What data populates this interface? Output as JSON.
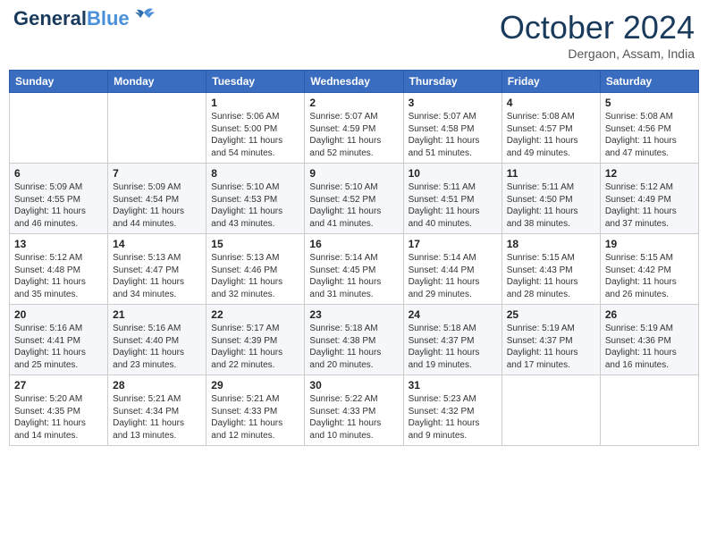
{
  "header": {
    "logo_line1": "General",
    "logo_line2": "Blue",
    "month": "October 2024",
    "location": "Dergaon, Assam, India"
  },
  "weekdays": [
    "Sunday",
    "Monday",
    "Tuesday",
    "Wednesday",
    "Thursday",
    "Friday",
    "Saturday"
  ],
  "weeks": [
    [
      {
        "day": null
      },
      {
        "day": null
      },
      {
        "day": 1,
        "sunrise": "Sunrise: 5:06 AM",
        "sunset": "Sunset: 5:00 PM",
        "daylight": "Daylight: 11 hours and 54 minutes."
      },
      {
        "day": 2,
        "sunrise": "Sunrise: 5:07 AM",
        "sunset": "Sunset: 4:59 PM",
        "daylight": "Daylight: 11 hours and 52 minutes."
      },
      {
        "day": 3,
        "sunrise": "Sunrise: 5:07 AM",
        "sunset": "Sunset: 4:58 PM",
        "daylight": "Daylight: 11 hours and 51 minutes."
      },
      {
        "day": 4,
        "sunrise": "Sunrise: 5:08 AM",
        "sunset": "Sunset: 4:57 PM",
        "daylight": "Daylight: 11 hours and 49 minutes."
      },
      {
        "day": 5,
        "sunrise": "Sunrise: 5:08 AM",
        "sunset": "Sunset: 4:56 PM",
        "daylight": "Daylight: 11 hours and 47 minutes."
      }
    ],
    [
      {
        "day": 6,
        "sunrise": "Sunrise: 5:09 AM",
        "sunset": "Sunset: 4:55 PM",
        "daylight": "Daylight: 11 hours and 46 minutes."
      },
      {
        "day": 7,
        "sunrise": "Sunrise: 5:09 AM",
        "sunset": "Sunset: 4:54 PM",
        "daylight": "Daylight: 11 hours and 44 minutes."
      },
      {
        "day": 8,
        "sunrise": "Sunrise: 5:10 AM",
        "sunset": "Sunset: 4:53 PM",
        "daylight": "Daylight: 11 hours and 43 minutes."
      },
      {
        "day": 9,
        "sunrise": "Sunrise: 5:10 AM",
        "sunset": "Sunset: 4:52 PM",
        "daylight": "Daylight: 11 hours and 41 minutes."
      },
      {
        "day": 10,
        "sunrise": "Sunrise: 5:11 AM",
        "sunset": "Sunset: 4:51 PM",
        "daylight": "Daylight: 11 hours and 40 minutes."
      },
      {
        "day": 11,
        "sunrise": "Sunrise: 5:11 AM",
        "sunset": "Sunset: 4:50 PM",
        "daylight": "Daylight: 11 hours and 38 minutes."
      },
      {
        "day": 12,
        "sunrise": "Sunrise: 5:12 AM",
        "sunset": "Sunset: 4:49 PM",
        "daylight": "Daylight: 11 hours and 37 minutes."
      }
    ],
    [
      {
        "day": 13,
        "sunrise": "Sunrise: 5:12 AM",
        "sunset": "Sunset: 4:48 PM",
        "daylight": "Daylight: 11 hours and 35 minutes."
      },
      {
        "day": 14,
        "sunrise": "Sunrise: 5:13 AM",
        "sunset": "Sunset: 4:47 PM",
        "daylight": "Daylight: 11 hours and 34 minutes."
      },
      {
        "day": 15,
        "sunrise": "Sunrise: 5:13 AM",
        "sunset": "Sunset: 4:46 PM",
        "daylight": "Daylight: 11 hours and 32 minutes."
      },
      {
        "day": 16,
        "sunrise": "Sunrise: 5:14 AM",
        "sunset": "Sunset: 4:45 PM",
        "daylight": "Daylight: 11 hours and 31 minutes."
      },
      {
        "day": 17,
        "sunrise": "Sunrise: 5:14 AM",
        "sunset": "Sunset: 4:44 PM",
        "daylight": "Daylight: 11 hours and 29 minutes."
      },
      {
        "day": 18,
        "sunrise": "Sunrise: 5:15 AM",
        "sunset": "Sunset: 4:43 PM",
        "daylight": "Daylight: 11 hours and 28 minutes."
      },
      {
        "day": 19,
        "sunrise": "Sunrise: 5:15 AM",
        "sunset": "Sunset: 4:42 PM",
        "daylight": "Daylight: 11 hours and 26 minutes."
      }
    ],
    [
      {
        "day": 20,
        "sunrise": "Sunrise: 5:16 AM",
        "sunset": "Sunset: 4:41 PM",
        "daylight": "Daylight: 11 hours and 25 minutes."
      },
      {
        "day": 21,
        "sunrise": "Sunrise: 5:16 AM",
        "sunset": "Sunset: 4:40 PM",
        "daylight": "Daylight: 11 hours and 23 minutes."
      },
      {
        "day": 22,
        "sunrise": "Sunrise: 5:17 AM",
        "sunset": "Sunset: 4:39 PM",
        "daylight": "Daylight: 11 hours and 22 minutes."
      },
      {
        "day": 23,
        "sunrise": "Sunrise: 5:18 AM",
        "sunset": "Sunset: 4:38 PM",
        "daylight": "Daylight: 11 hours and 20 minutes."
      },
      {
        "day": 24,
        "sunrise": "Sunrise: 5:18 AM",
        "sunset": "Sunset: 4:37 PM",
        "daylight": "Daylight: 11 hours and 19 minutes."
      },
      {
        "day": 25,
        "sunrise": "Sunrise: 5:19 AM",
        "sunset": "Sunset: 4:37 PM",
        "daylight": "Daylight: 11 hours and 17 minutes."
      },
      {
        "day": 26,
        "sunrise": "Sunrise: 5:19 AM",
        "sunset": "Sunset: 4:36 PM",
        "daylight": "Daylight: 11 hours and 16 minutes."
      }
    ],
    [
      {
        "day": 27,
        "sunrise": "Sunrise: 5:20 AM",
        "sunset": "Sunset: 4:35 PM",
        "daylight": "Daylight: 11 hours and 14 minutes."
      },
      {
        "day": 28,
        "sunrise": "Sunrise: 5:21 AM",
        "sunset": "Sunset: 4:34 PM",
        "daylight": "Daylight: 11 hours and 13 minutes."
      },
      {
        "day": 29,
        "sunrise": "Sunrise: 5:21 AM",
        "sunset": "Sunset: 4:33 PM",
        "daylight": "Daylight: 11 hours and 12 minutes."
      },
      {
        "day": 30,
        "sunrise": "Sunrise: 5:22 AM",
        "sunset": "Sunset: 4:33 PM",
        "daylight": "Daylight: 11 hours and 10 minutes."
      },
      {
        "day": 31,
        "sunrise": "Sunrise: 5:23 AM",
        "sunset": "Sunset: 4:32 PM",
        "daylight": "Daylight: 11 hours and 9 minutes."
      },
      {
        "day": null
      },
      {
        "day": null
      }
    ]
  ]
}
